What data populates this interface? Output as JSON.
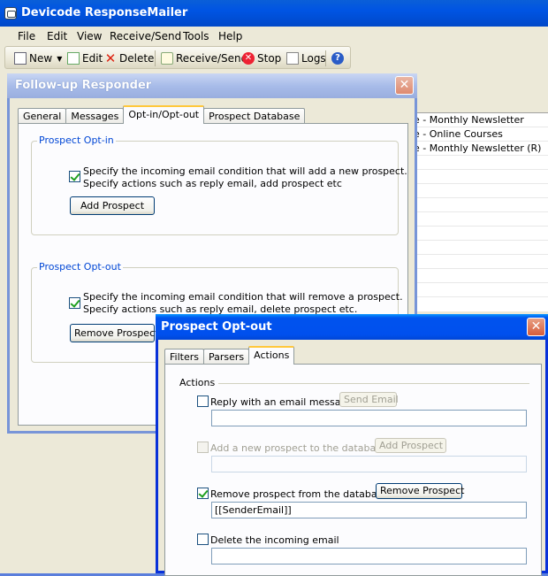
{
  "app": {
    "title": "Devicode ResponseMailer",
    "menu": [
      "File",
      "Edit",
      "View",
      "Receive/Send",
      "Tools",
      "Help"
    ],
    "toolbar": {
      "new_label": "New",
      "edit_label": "Edit",
      "delete_label": "Delete",
      "receive_send_label": "Receive/Send",
      "stop_label": "Stop",
      "logs_label": "Logs"
    },
    "background_list": [
      "e - Monthly Newsletter",
      "e - Online Courses",
      "e - Monthly Newsletter (R)"
    ]
  },
  "followup_dialog": {
    "title": "Follow-up Responder",
    "tabs": [
      "General",
      "Messages",
      "Opt-in/Opt-out",
      "Prospect Database"
    ],
    "active_tab": "Opt-in/Opt-out",
    "optin": {
      "group_title": "Prospect Opt-in",
      "checkbox_line1": "Specify the incoming email condition that will add a new prospect.",
      "checkbox_line2": "Specify actions such as reply email, add prospect etc",
      "checked": true,
      "button_label": "Add Prospect"
    },
    "optout": {
      "group_title": "Prospect Opt-out",
      "checkbox_line1": "Specify the incoming email condition that will remove a prospect.",
      "checkbox_line2": "Specify actions such as reply email, delete prospect etc.",
      "checked": true,
      "button_label": "Remove Prospect"
    }
  },
  "optout_dialog": {
    "title": "Prospect Opt-out",
    "tabs": [
      "Filters",
      "Parsers",
      "Actions"
    ],
    "active_tab": "Actions",
    "section_label": "Actions",
    "reply": {
      "label": "Reply with an email message",
      "checked": false,
      "button_label": "Send Email",
      "value": ""
    },
    "add_prospect": {
      "label": "Add a new prospect to the database",
      "checked": false,
      "enabled": false,
      "button_label": "Add Prospect",
      "value": ""
    },
    "remove_prospect": {
      "label": "Remove prospect from the database",
      "checked": true,
      "button_label": "Remove Prospect",
      "value": "[[SenderEmail]]"
    },
    "delete_email": {
      "label": "Delete the incoming email",
      "checked": false,
      "value": ""
    }
  }
}
